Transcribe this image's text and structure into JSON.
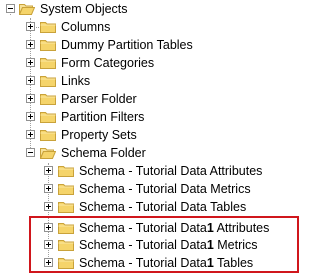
{
  "tree": {
    "root": {
      "label": "System Objects",
      "icon": "folder-open-icon",
      "expanded": true
    },
    "children": [
      {
        "label": "Columns",
        "icon": "folder-icon",
        "expanded": false
      },
      {
        "label": "Dummy Partition Tables",
        "icon": "folder-icon",
        "expanded": false
      },
      {
        "label": "Form Categories",
        "icon": "folder-icon",
        "expanded": false
      },
      {
        "label": "Links",
        "icon": "folder-icon",
        "expanded": false
      },
      {
        "label": "Parser Folder",
        "icon": "folder-icon",
        "expanded": false
      },
      {
        "label": "Partition Filters",
        "icon": "folder-icon",
        "expanded": false
      },
      {
        "label": "Property Sets",
        "icon": "folder-icon",
        "expanded": false
      },
      {
        "label": "Schema Folder",
        "icon": "folder-open-icon",
        "expanded": true,
        "children": [
          {
            "label": "Schema - Tutorial Data Attributes",
            "icon": "folder-icon",
            "expanded": false
          },
          {
            "label": "Schema - Tutorial Data Metrics",
            "icon": "folder-icon",
            "expanded": false
          },
          {
            "label": "Schema - Tutorial Data Tables",
            "icon": "folder-icon",
            "expanded": false
          },
          {
            "label_prefix": "Schema - Tutorial Data",
            "label_bold": "1",
            "label_suffix": " Attributes",
            "icon": "folder-icon",
            "expanded": false,
            "highlighted": true
          },
          {
            "label_prefix": "Schema - Tutorial Data",
            "label_bold": "1",
            "label_suffix": " Metrics",
            "icon": "folder-icon",
            "expanded": false,
            "highlighted": true
          },
          {
            "label_prefix": "Schema - Tutorial Data",
            "label_bold": "1",
            "label_suffix": " Tables",
            "icon": "folder-icon",
            "expanded": false,
            "highlighted": true
          }
        ]
      }
    ]
  },
  "colors": {
    "highlight_border": "#d0161c",
    "folder_fill": "#f5d46a",
    "folder_stroke": "#c9a23a"
  }
}
